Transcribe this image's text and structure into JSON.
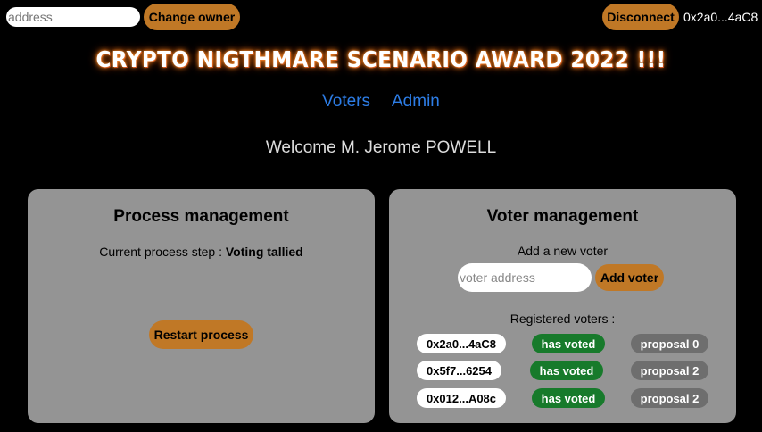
{
  "header": {
    "owner_input_placeholder": "address",
    "change_owner_label": "Change owner",
    "disconnect_label": "Disconnect",
    "account": "0x2a0...4aC8"
  },
  "title": "CRYPTO NIGTHMARE SCENARIO AWARD 2022 !!!",
  "nav": {
    "voters": "Voters",
    "admin": "Admin"
  },
  "welcome": "Welcome M. Jerome POWELL",
  "process": {
    "heading": "Process management",
    "step_prefix": "Current process step :",
    "step_value": "Voting tallied",
    "restart_label": "Restart process"
  },
  "voter_mgmt": {
    "heading": "Voter management",
    "add_label": "Add a new voter",
    "input_placeholder": "voter address",
    "add_button": "Add voter",
    "registered_label": "Registered voters :",
    "voters": [
      {
        "address": "0x2a0...4aC8",
        "status": "has voted",
        "proposal": "proposal 0"
      },
      {
        "address": "0x5f7...6254",
        "status": "has voted",
        "proposal": "proposal 2"
      },
      {
        "address": "0x012...A08c",
        "status": "has voted",
        "proposal": "proposal 2"
      }
    ]
  },
  "colors": {
    "accent": "#c07826",
    "link": "#2d7de6",
    "panel": "#949494",
    "voted": "#177a2b",
    "proposal": "#6e6e6e"
  }
}
